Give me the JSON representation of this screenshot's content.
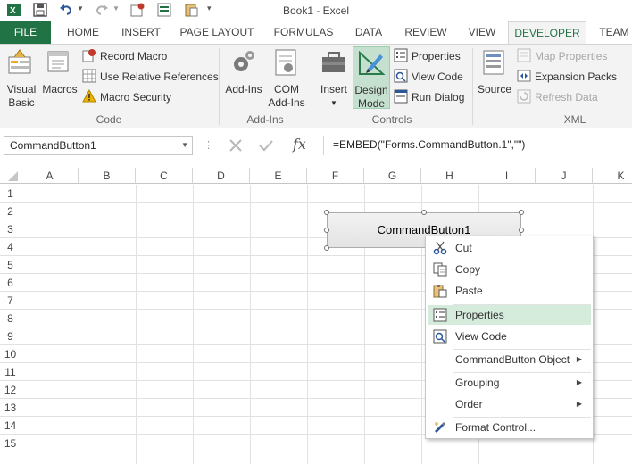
{
  "window": {
    "title": "Book1 - Excel"
  },
  "ribbon_tabs": [
    "FILE",
    "HOME",
    "INSERT",
    "PAGE LAYOUT",
    "FORMULAS",
    "DATA",
    "REVIEW",
    "VIEW",
    "DEVELOPER",
    "TEAM"
  ],
  "ribbon": {
    "code": {
      "visual_basic": "Visual Basic",
      "visual_basic_l1": "Visual",
      "visual_basic_l2": "Basic",
      "macros": "Macros",
      "record_macro": "Record Macro",
      "use_relative": "Use Relative References",
      "macro_security": "Macro Security",
      "group_label": "Code"
    },
    "addins": {
      "addins": "Add-Ins",
      "com_l1": "COM",
      "com_l2": "Add-Ins",
      "group_label": "Add-Ins"
    },
    "controls": {
      "insert": "Insert",
      "design_l1": "Design",
      "design_l2": "Mode",
      "properties": "Properties",
      "view_code": "View Code",
      "run_dialog": "Run Dialog",
      "group_label": "Controls"
    },
    "xml": {
      "source": "Source",
      "map_properties": "Map Properties",
      "expansion_packs": "Expansion Packs",
      "refresh_data": "Refresh Data",
      "group_label": "XML"
    }
  },
  "formula_bar": {
    "name_box": "CommandButton1",
    "fx": "fx",
    "formula": "=EMBED(\"Forms.CommandButton.1\",\"\")"
  },
  "grid": {
    "columns": [
      "A",
      "B",
      "C",
      "D",
      "E",
      "F",
      "G",
      "H",
      "I",
      "J",
      "K"
    ],
    "rows": [
      "1",
      "2",
      "3",
      "4",
      "5",
      "6",
      "7",
      "8",
      "9",
      "10",
      "11",
      "12",
      "13",
      "14",
      "15"
    ]
  },
  "command_button": {
    "label": "CommandButton1"
  },
  "context_menu": {
    "items": [
      {
        "label": "Cut",
        "icon": "scissors-icon"
      },
      {
        "label": "Copy",
        "icon": "copy-icon"
      },
      {
        "label": "Paste",
        "icon": "paste-icon"
      },
      {
        "label": "Properties",
        "icon": "properties-icon",
        "highlighted": true
      },
      {
        "label": "View Code",
        "icon": "view-code-icon"
      },
      {
        "label": "CommandButton Object",
        "submenu": true
      },
      {
        "label": "Grouping",
        "submenu": true
      },
      {
        "label": "Order",
        "submenu": true
      },
      {
        "label": "Format Control...",
        "icon": "format-control-icon"
      }
    ]
  },
  "colors": {
    "excel_green": "#217346",
    "highlight": "#d5ebdc"
  }
}
